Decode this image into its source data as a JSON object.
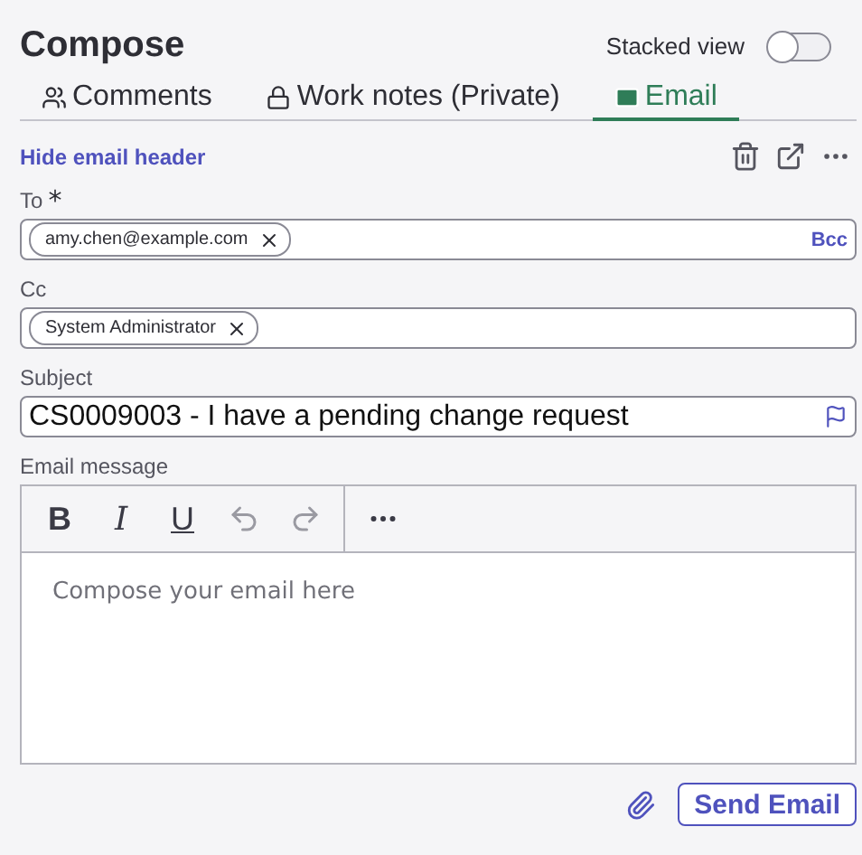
{
  "title": "Compose",
  "stacked_view": {
    "label": "Stacked view",
    "on": false
  },
  "tabs": [
    {
      "label": "Comments",
      "selected": false
    },
    {
      "label": "Work notes (Private)",
      "selected": false
    },
    {
      "label": "Email",
      "selected": true
    }
  ],
  "header_link": "Hide email header",
  "to": {
    "label": "To",
    "required_mark": "*",
    "chips": [
      "amy.chen@example.com"
    ],
    "bcc": "Bcc"
  },
  "cc": {
    "label": "Cc",
    "chips": [
      "System Administrator"
    ]
  },
  "subject": {
    "label": "Subject",
    "value": "CS0009003 - I have a pending change request"
  },
  "message": {
    "label": "Email message",
    "placeholder": "Compose your email here",
    "toolbar": [
      {
        "kind": "bold",
        "text": "B",
        "disabled": false
      },
      {
        "kind": "italic",
        "text": "I",
        "disabled": false
      },
      {
        "kind": "underline",
        "text": "U",
        "disabled": false
      },
      {
        "kind": "undo",
        "disabled": true
      },
      {
        "kind": "redo",
        "disabled": true
      },
      {
        "kind": "more",
        "disabled": false
      }
    ]
  },
  "send_button": "Send Email"
}
